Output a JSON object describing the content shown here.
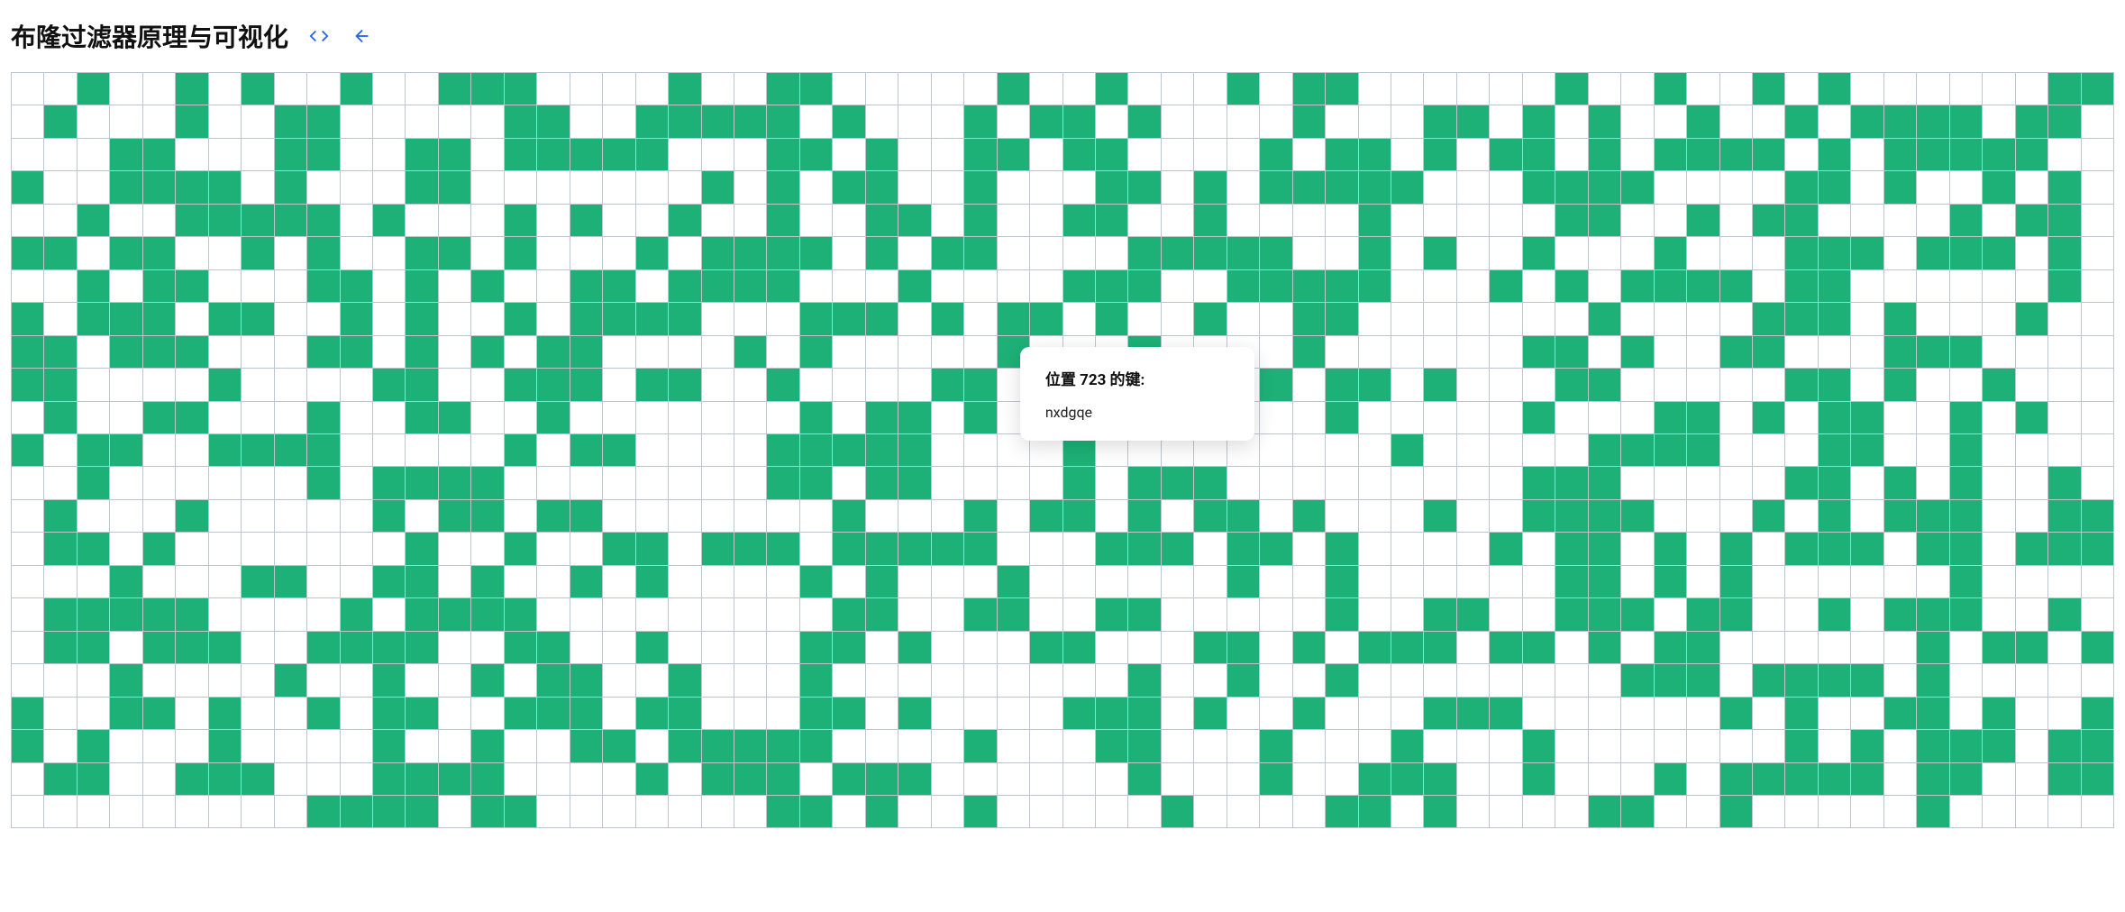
{
  "header": {
    "title": "布隆过滤器原理与可视化"
  },
  "tooltip": {
    "title_prefix": "位置 ",
    "position": "723",
    "title_suffix": " 的键:",
    "value": "nxdgqe"
  },
  "grid": {
    "cols": 64,
    "rows": 23,
    "bits": "0010010100100111000010011000001001000101100000010010010100000011010001001100000110011111010001011010000100011010100100101111011000011000110011011111000110100110110000101101011010111101011111001001111010001100000001010110010001101011111000111100001101001010001001111101000101001001001101001100100001000001100101100001011011011001010011010001011110101100001111100101001000100011101110100010110001101010011011110001000011100111110001010111101100000010101110110010100101111000111010110100100110000000100001110100010011011100011010101100001010000010001000010000001101001100011100001100001000011001110110010000110110011010110100011000001101001000010011000100110010000000101101010010100010000010001101011001010010110011110000010110000111110000100000000010000011110001100100000010000001011110000000011011000010111000000000111000001101010010010001000001011011000000010001011010110100010011110001010111001101101000000010010011011101111100011101101000010110101011101101110001000110011010010100001010001000000100100000011010100000010000011111000010111100000000011001100110000010011001110110010111001001101110011110011001000011010001100011010111011010110000001011010001000010010010110010001000000000100100100000000111011110100000100110100101100111011000110100001110100100011100000010100110100110100010000100100110111110000100011000100010001000000010101110110110011100011110000101110111000000100010011100100010111110110011000000000111101100000001101001000001000011010000110010000010"
  }
}
